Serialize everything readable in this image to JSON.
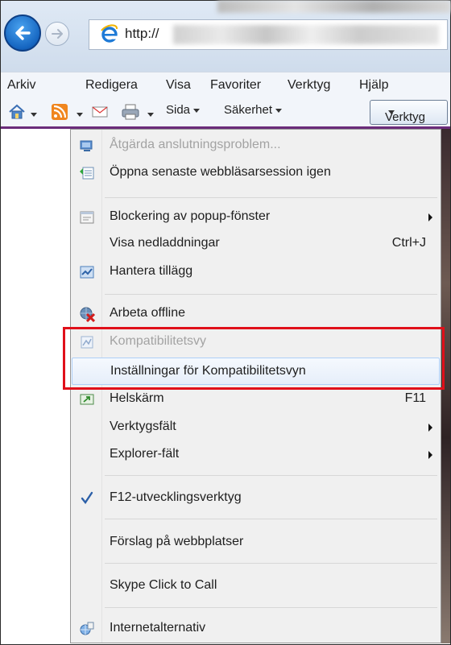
{
  "address_bar": {
    "url_prefix": "http://"
  },
  "menu_bar": [
    "Arkiv",
    "Redigera",
    "Visa",
    "Favoriter",
    "Verktyg",
    "Hjälp"
  ],
  "command_bar": {
    "page": "Sida",
    "safety": "Säkerhet",
    "tools": "Verktyg"
  },
  "tools_menu": [
    {
      "label": "Åtgärda anslutningsproblem...",
      "icon": "network-repair-icon",
      "disabled": true
    },
    {
      "label": "Öppna senaste webbläsarsession igen",
      "icon": "reopen-session-icon"
    },
    {
      "label": "Blockering av popup-fönster",
      "icon": "popup-blocker-icon",
      "submenu": true
    },
    {
      "label": "Visa nedladdningar",
      "shortcut": "Ctrl+J"
    },
    {
      "label": "Hantera tillägg",
      "icon": "addons-icon"
    },
    {
      "label": "Arbeta offline",
      "icon": "offline-icon"
    },
    {
      "label": "Kompatibilitetsvy",
      "icon": "compatibility-view-icon",
      "disabled": true
    },
    {
      "label": "Inställningar för Kompatibilitetsvyn",
      "hovered": true
    },
    {
      "label": "Helskärm",
      "icon": "fullscreen-icon",
      "shortcut": "F11"
    },
    {
      "label": "Verktygsfält",
      "submenu": true
    },
    {
      "label": "Explorer-fält",
      "submenu": true
    },
    {
      "label": "F12-utvecklingsverktyg",
      "icon": "checkmark-icon"
    },
    {
      "label": "Förslag på webbplatser"
    },
    {
      "label": "Skype Click to Call"
    },
    {
      "label": "Internetalternativ",
      "icon": "internet-options-icon"
    }
  ],
  "colors": {
    "highlight_border": "#e0101a",
    "menu_background": "#f0f0f0",
    "hover_border": "#aecff7",
    "accent_blue": "#1565c0"
  }
}
